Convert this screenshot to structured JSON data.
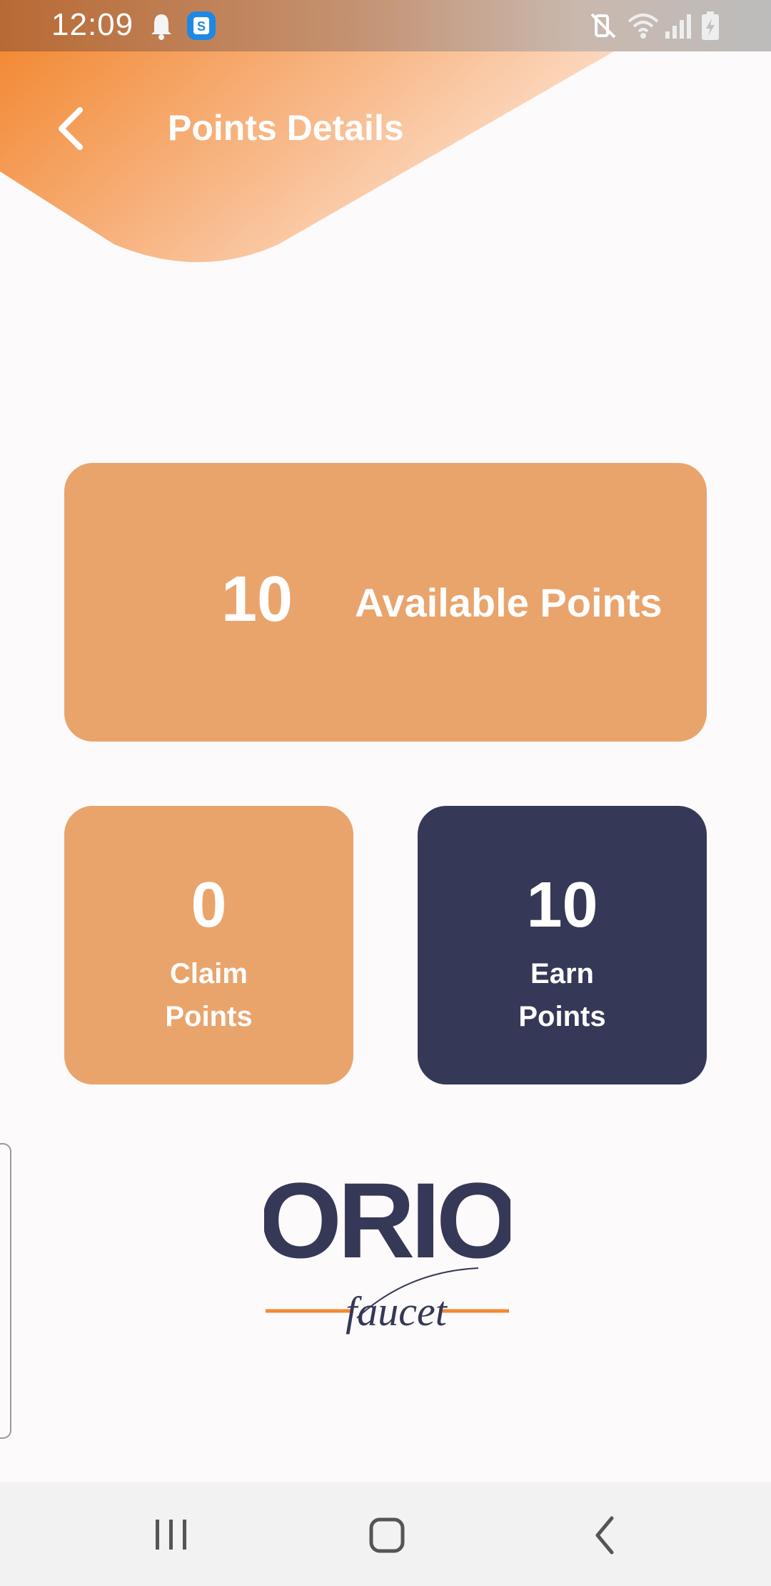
{
  "status_bar": {
    "time": "12:09",
    "icons": [
      "notification-bell-icon",
      "app-s-icon",
      "mute-vibrate-icon",
      "wifi-icon",
      "signal-icon",
      "battery-charging-icon"
    ]
  },
  "header": {
    "title": "Points Details",
    "back_icon": "chevron-left-icon",
    "gradient_colors": [
      "#f28a35",
      "#fde4d2"
    ]
  },
  "points": {
    "available": {
      "value": "10",
      "label": "Available Points",
      "color": "#e9a46c"
    },
    "claim": {
      "value": "0",
      "label_line1": "Claim",
      "label_line2": "Points",
      "color": "#e9a46c"
    },
    "earn": {
      "value": "10",
      "label_line1": "Earn",
      "label_line2": "Points",
      "color": "#353856"
    }
  },
  "logo": {
    "brand": "ORIO",
    "tagline": "faucet"
  },
  "nav_bar": {
    "buttons": [
      "recent-apps-icon",
      "home-icon",
      "back-icon"
    ]
  }
}
